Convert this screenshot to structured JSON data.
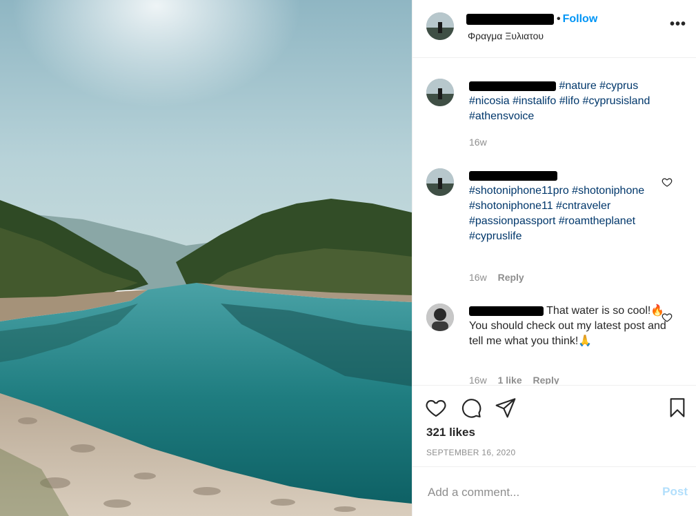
{
  "header": {
    "follow_label": "Follow",
    "location": "Φραγμα Ξυλιατου",
    "more_icon": "more-options-icon"
  },
  "comments": [
    {
      "hashtags": "#nature #cyprus #nicosia #instalifo #lifo #cyprusisland #athensvoice",
      "time": "16w"
    },
    {
      "hashtags": "#shotoniphone11pro #shotoniphone #shotoniphone11 #cntraveler #passionpassport #roamtheplanet #cypruslife",
      "time": "16w",
      "reply_label": "Reply"
    },
    {
      "text": "That water is so cool!🔥 You should check out my latest post and tell me what you think!🙏",
      "time": "16w",
      "likes": "1 like",
      "reply_label": "Reply"
    }
  ],
  "actions": {
    "likes": "321 likes",
    "date": "SEPTEMBER 16, 2020"
  },
  "composer": {
    "placeholder": "Add a comment...",
    "post_label": "Post"
  },
  "colors": {
    "link_blue": "#0095f6",
    "hashtag": "#00376b",
    "muted": "#8e8e8e",
    "post_disabled": "#b2dffc"
  }
}
